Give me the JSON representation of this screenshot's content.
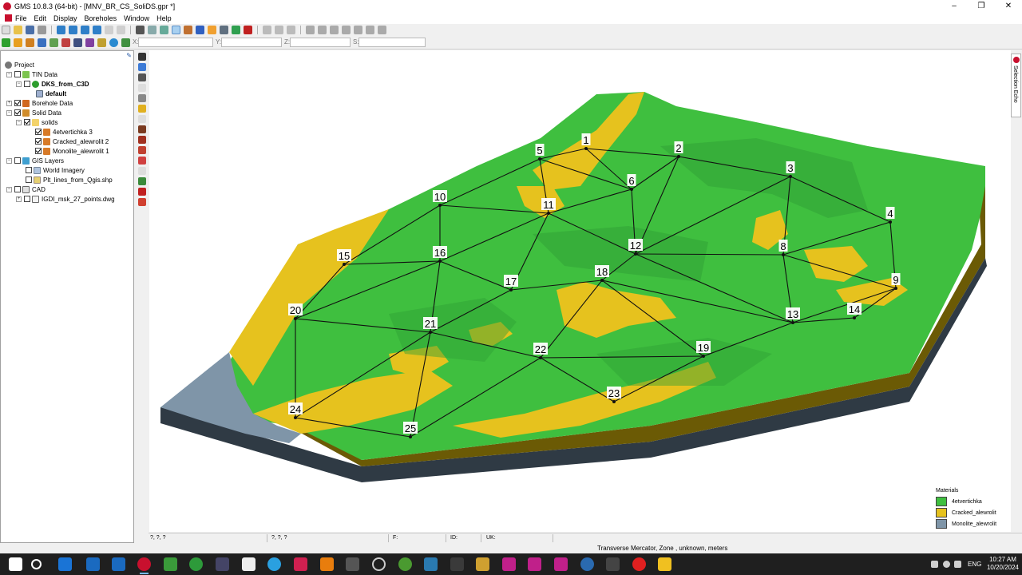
{
  "window": {
    "title": "GMS 10.8.3 (64-bit) - [MNV_BR_CS_SoliDS.gpr *]",
    "controls": [
      "–",
      "❐",
      "✕"
    ]
  },
  "menu": [
    "File",
    "Edit",
    "Display",
    "Boreholes",
    "Window",
    "Help"
  ],
  "coords": {
    "x_label": "X:",
    "y_label": "Y:",
    "z_label": "Z:",
    "s_label": "S:"
  },
  "explorer": {
    "root": "Project",
    "tin_data": "TIN Data",
    "tin_item": "DKS_from_C3D",
    "tin_sub": "default",
    "borehole": "Borehole Data",
    "solid": "Solid Data",
    "solids_folder": "solids",
    "solid_items": [
      "4etvertichka 3",
      "Cracked_alewrolit 2",
      "Monolite_alewrolit 1"
    ],
    "gis": "GIS Layers",
    "gis_items": [
      "World Imagery",
      "Plt_lines_from_Qgis.shp"
    ],
    "cad": "CAD",
    "cad_item": "IGDI_msk_27_points.dwg"
  },
  "selection_echo": "Selection Echo",
  "scene": {
    "node_labels": [
      "1",
      "2",
      "3",
      "4",
      "5",
      "6",
      "8",
      "9",
      "10",
      "11",
      "12",
      "13",
      "14",
      "15",
      "16",
      "17",
      "18",
      "19",
      "20",
      "21",
      "22",
      "23",
      "24",
      "25"
    ],
    "colors": {
      "green": "#3fbf3f",
      "yellow": "#e6c21e",
      "steel": "#7f95a8",
      "olive": "#6b5a05",
      "dark": "#2f3a44"
    }
  },
  "legend": {
    "title": "Materials",
    "items": [
      {
        "label": "4etvertichka",
        "color": "#3fbf3f"
      },
      {
        "label": "Cracked_alewrolit",
        "color": "#e6c21e"
      },
      {
        "label": "Monolite_alewrolit",
        "color": "#7f95a8"
      }
    ]
  },
  "status": {
    "a": "?, ?, ?",
    "b": "?, ?, ?",
    "f": "F:",
    "id": "ID:",
    "uk": "UK:"
  },
  "projection": "Transverse Mercator,  Zone ,  unknown,  meters",
  "taskbar": {
    "lang": "ENG",
    "time": "10:27 AM",
    "date": "10/20/2024"
  }
}
